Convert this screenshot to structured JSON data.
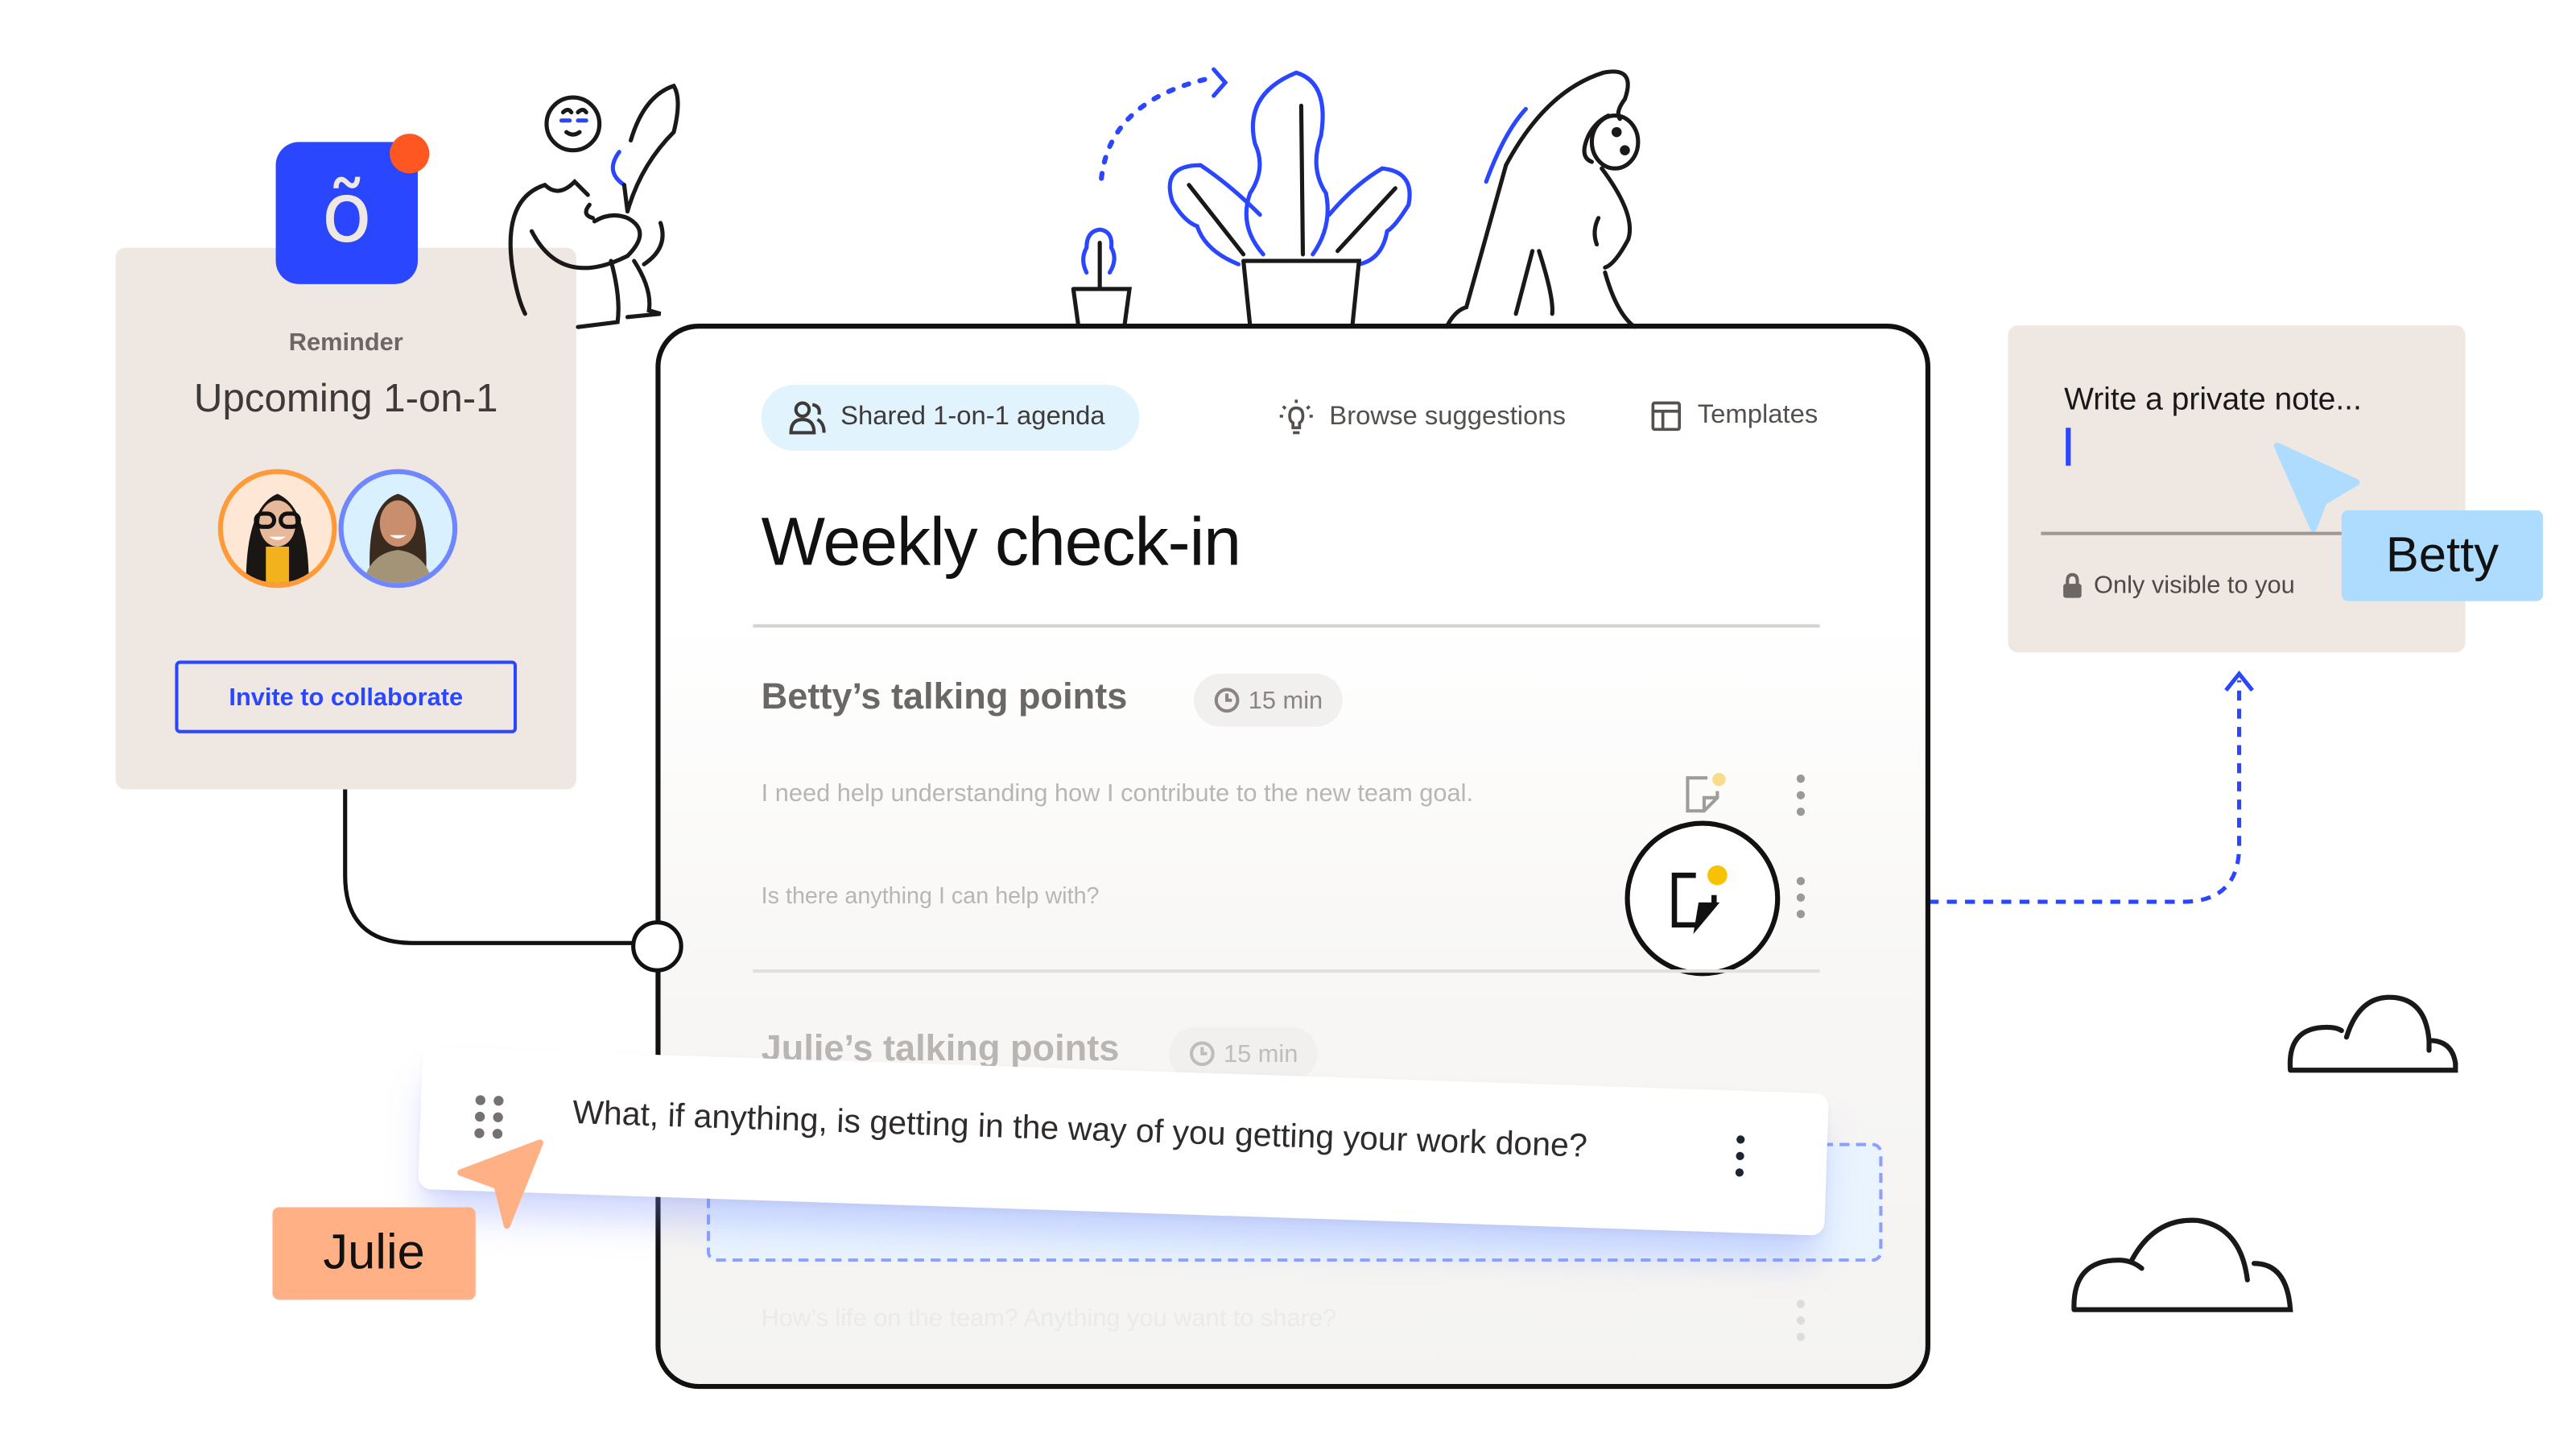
{
  "reminder": {
    "app_icon_glyph": "õ",
    "label": "Reminder",
    "title": "Upcoming 1-on-1",
    "avatars": [
      {
        "name": "participant-1",
        "ring_color": "#ff9a3b"
      },
      {
        "name": "participant-2",
        "ring_color": "#6f86ff"
      }
    ],
    "invite_button": "Invite to collaborate"
  },
  "agenda": {
    "shared_pill": "Shared 1-on-1 agenda",
    "browse_suggestions": "Browse suggestions",
    "templates": "Templates",
    "title": "Weekly check-in",
    "sections": [
      {
        "title": "Betty’s talking points",
        "duration": "15 min",
        "items": [
          "I need help understanding how I contribute to the new team goal.",
          "Is there anything I can help with?"
        ]
      },
      {
        "title": "Julie’s talking points",
        "duration": "15 min",
        "items": [
          "What, if anything, is getting in the way of you getting your work done?",
          "How’s life on the team? Anything you want to share?"
        ]
      }
    ]
  },
  "private_note": {
    "placeholder": "Write a private note...",
    "visibility": "Only visible to you"
  },
  "cursors": {
    "julie": {
      "label": "Julie",
      "color": "#ffb084"
    },
    "betty": {
      "label": "Betty",
      "color": "#aedcff"
    }
  },
  "colors": {
    "brand_blue": "#2b46ff",
    "notification": "#ff5722",
    "card_beige": "#efe8e2",
    "note_dot": "#f7c300"
  }
}
